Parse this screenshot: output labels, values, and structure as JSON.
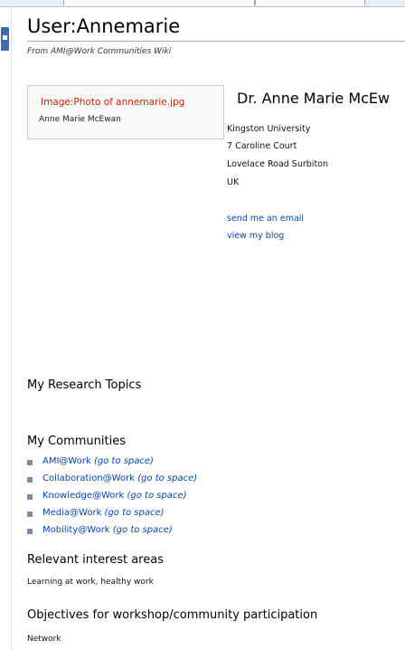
{
  "page": {
    "title": "User:Annemarie",
    "subtitle": "From AMI@Work Communities Wiki"
  },
  "image_box": {
    "broken_link": "Image:Photo of annemarie.jpg",
    "caption": "Anne Marie McEwan"
  },
  "profile": {
    "name": "Dr. Anne Marie McEw",
    "address": [
      "Kingston University",
      "7 Caroline Court",
      "Lovelace Road Surbiton",
      "UK"
    ],
    "links": {
      "email": "send me an email",
      "blog": "view my blog"
    }
  },
  "sections": {
    "research_topics": "My Research Topics",
    "communities": "My Communities",
    "interest": "Relevant interest areas",
    "objectives": "Objectives for workshop/community participation"
  },
  "communities": [
    {
      "name": "AMI@Work",
      "go": "(go to space)"
    },
    {
      "name": "Collaboration@Work",
      "go": "(go to space)"
    },
    {
      "name": "Knowledge@Work",
      "go": "(go to space)"
    },
    {
      "name": "Media@Work",
      "go": "(go to space)"
    },
    {
      "name": "Mobility@Work",
      "go": "(go to space)"
    }
  ],
  "texts": {
    "interest": "Learning at work, healthy work",
    "objectives": "Network"
  },
  "colors": {
    "link": "#0645ad",
    "broken_link": "#cc2200",
    "bullet": "#7d8ba3"
  }
}
